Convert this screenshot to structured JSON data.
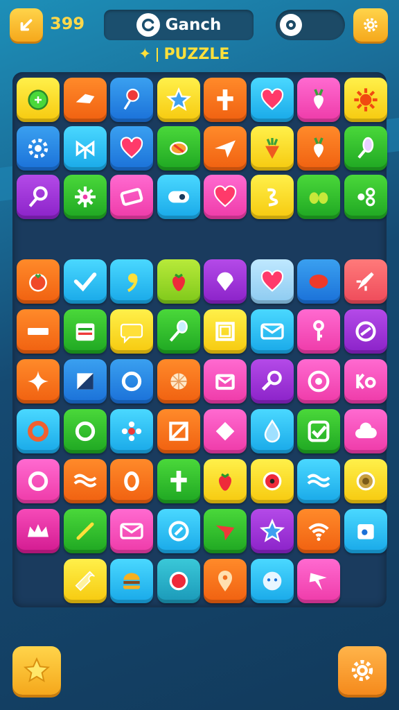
{
  "header": {
    "score": "399",
    "title": "Ganch",
    "subtitle_label": "PUZZLE"
  },
  "colors": {
    "accent": "#f5a81c",
    "score": "#ffd84a",
    "board_bg": "#1a3b5e"
  },
  "board": {
    "tiles": [
      {
        "row": 0,
        "col": 0,
        "color": "yellow",
        "icon": "green-button-icon"
      },
      {
        "row": 0,
        "col": 1,
        "color": "orange",
        "icon": "paper-icon"
      },
      {
        "row": 0,
        "col": 2,
        "color": "blue",
        "icon": "pin-icon"
      },
      {
        "row": 0,
        "col": 3,
        "color": "yellow",
        "icon": "star-icon"
      },
      {
        "row": 0,
        "col": 4,
        "color": "orange",
        "icon": "cross-icon"
      },
      {
        "row": 0,
        "col": 5,
        "color": "cyan",
        "icon": "heart-icon"
      },
      {
        "row": 0,
        "col": 6,
        "color": "pink",
        "icon": "radish-icon"
      },
      {
        "row": 0,
        "col": 7,
        "color": "yellow",
        "icon": "sun-icon"
      },
      {
        "row": 1,
        "col": 0,
        "color": "blue",
        "icon": "gear-icon"
      },
      {
        "row": 1,
        "col": 1,
        "color": "cyan",
        "icon": "bow-icon"
      },
      {
        "row": 1,
        "col": 2,
        "color": "blue",
        "icon": "heart-icon"
      },
      {
        "row": 1,
        "col": 3,
        "color": "green",
        "icon": "candy-icon"
      },
      {
        "row": 1,
        "col": 4,
        "color": "orange",
        "icon": "paper-plane-icon"
      },
      {
        "row": 1,
        "col": 5,
        "color": "yellow",
        "icon": "carrot-icon"
      },
      {
        "row": 1,
        "col": 6,
        "color": "orange",
        "icon": "radish-icon"
      },
      {
        "row": 1,
        "col": 7,
        "color": "green",
        "icon": "popsicle-icon"
      },
      {
        "row": 2,
        "col": 0,
        "color": "purple",
        "icon": "lollipop-icon"
      },
      {
        "row": 2,
        "col": 1,
        "color": "green",
        "icon": "splat-icon"
      },
      {
        "row": 2,
        "col": 2,
        "color": "pink",
        "icon": "tag-icon"
      },
      {
        "row": 2,
        "col": 3,
        "color": "cyan",
        "icon": "capsule-icon"
      },
      {
        "row": 2,
        "col": 4,
        "color": "pink",
        "icon": "heart-icon"
      },
      {
        "row": 2,
        "col": 5,
        "color": "yellow",
        "icon": "swirl-icon"
      },
      {
        "row": 2,
        "col": 6,
        "color": "green",
        "icon": "olives-icon"
      },
      {
        "row": 2,
        "col": 7,
        "color": "green",
        "icon": "circles-icon"
      },
      {
        "row": 3,
        "col": 0,
        "color": "orange",
        "icon": "tomato-icon"
      },
      {
        "row": 3,
        "col": 1,
        "color": "cyan",
        "icon": "checkmark-icon"
      },
      {
        "row": 3,
        "col": 2,
        "color": "cyan",
        "icon": "comma-icon"
      },
      {
        "row": 3,
        "col": 3,
        "color": "lime",
        "icon": "strawberry-icon"
      },
      {
        "row": 3,
        "col": 4,
        "color": "purple",
        "icon": "shell-icon"
      },
      {
        "row": 3,
        "col": 5,
        "color": "lightblue",
        "icon": "heart-icon"
      },
      {
        "row": 3,
        "col": 6,
        "color": "blue",
        "icon": "bean-icon"
      },
      {
        "row": 3,
        "col": 7,
        "color": "red",
        "icon": "rocket-icon"
      },
      {
        "row": 4,
        "col": 0,
        "color": "orange",
        "icon": "bar-icon"
      },
      {
        "row": 4,
        "col": 1,
        "color": "green",
        "icon": "calendar-icon"
      },
      {
        "row": 4,
        "col": 2,
        "color": "yellow",
        "icon": "speech-bubble-icon"
      },
      {
        "row": 4,
        "col": 3,
        "color": "green",
        "icon": "spoon-icon"
      },
      {
        "row": 4,
        "col": 4,
        "color": "yellow",
        "icon": "frame-icon"
      },
      {
        "row": 4,
        "col": 5,
        "color": "cyan",
        "icon": "envelope-icon"
      },
      {
        "row": 4,
        "col": 6,
        "color": "pink",
        "icon": "key-icon"
      },
      {
        "row": 4,
        "col": 7,
        "color": "purple",
        "icon": "circle-slash-icon"
      },
      {
        "row": 5,
        "col": 0,
        "color": "orange",
        "icon": "sparkle-icon"
      },
      {
        "row": 5,
        "col": 1,
        "color": "blue",
        "icon": "envelope-flag-icon"
      },
      {
        "row": 5,
        "col": 2,
        "color": "blue",
        "icon": "ring-icon"
      },
      {
        "row": 5,
        "col": 3,
        "color": "orange",
        "icon": "shell-round-icon"
      },
      {
        "row": 5,
        "col": 4,
        "color": "pink",
        "icon": "mailbox-icon"
      },
      {
        "row": 5,
        "col": 5,
        "color": "purple",
        "icon": "magnifier-icon"
      },
      {
        "row": 5,
        "col": 6,
        "color": "pink",
        "icon": "target-icon"
      },
      {
        "row": 5,
        "col": 7,
        "color": "pink",
        "icon": "ko-icon"
      },
      {
        "row": 6,
        "col": 0,
        "color": "cyan",
        "icon": "donut-icon"
      },
      {
        "row": 6,
        "col": 1,
        "color": "green",
        "icon": "ring-icon"
      },
      {
        "row": 6,
        "col": 2,
        "color": "cyan",
        "icon": "flower-icon"
      },
      {
        "row": 6,
        "col": 3,
        "color": "orange",
        "icon": "square-slash-icon"
      },
      {
        "row": 6,
        "col": 4,
        "color": "pink",
        "icon": "diamond-icon"
      },
      {
        "row": 6,
        "col": 5,
        "color": "cyan",
        "icon": "drop-icon"
      },
      {
        "row": 6,
        "col": 6,
        "color": "green",
        "icon": "check-box-icon"
      },
      {
        "row": 6,
        "col": 7,
        "color": "pink",
        "icon": "cloud-icon"
      },
      {
        "row": 7,
        "col": 0,
        "color": "pink",
        "icon": "ring-icon"
      },
      {
        "row": 7,
        "col": 1,
        "color": "orange",
        "icon": "waves-icon"
      },
      {
        "row": 7,
        "col": 2,
        "color": "orange",
        "icon": "zero-icon"
      },
      {
        "row": 7,
        "col": 3,
        "color": "green",
        "icon": "cross-icon"
      },
      {
        "row": 7,
        "col": 4,
        "color": "yellow",
        "icon": "strawberry-icon"
      },
      {
        "row": 7,
        "col": 5,
        "color": "yellow",
        "icon": "ladybug-icon"
      },
      {
        "row": 7,
        "col": 6,
        "color": "cyan",
        "icon": "waves-icon"
      },
      {
        "row": 7,
        "col": 7,
        "color": "yellow",
        "icon": "button-icon"
      },
      {
        "row": 8,
        "col": 0,
        "color": "magenta",
        "icon": "crown-icon"
      },
      {
        "row": 8,
        "col": 1,
        "color": "green",
        "icon": "stick-icon"
      },
      {
        "row": 8,
        "col": 2,
        "color": "pink",
        "icon": "envelope-icon"
      },
      {
        "row": 8,
        "col": 3,
        "color": "cyan",
        "icon": "at-icon"
      },
      {
        "row": 8,
        "col": 4,
        "color": "green",
        "icon": "arrow-icon"
      },
      {
        "row": 8,
        "col": 5,
        "color": "purple",
        "icon": "star-icon"
      },
      {
        "row": 8,
        "col": 6,
        "color": "orange",
        "icon": "wifi-icon"
      },
      {
        "row": 8,
        "col": 7,
        "color": "cyan",
        "icon": "camera-icon"
      },
      {
        "row": 9,
        "col": 1,
        "color": "yellow",
        "icon": "ticket-icon"
      },
      {
        "row": 9,
        "col": 2,
        "color": "cyan",
        "icon": "burger-icon"
      },
      {
        "row": 9,
        "col": 3,
        "color": "teal",
        "icon": "ball-icon"
      },
      {
        "row": 9,
        "col": 4,
        "color": "orange",
        "icon": "map-pin-icon"
      },
      {
        "row": 9,
        "col": 5,
        "color": "cyan",
        "icon": "face-icon"
      },
      {
        "row": 9,
        "col": 6,
        "color": "pink",
        "icon": "spark-icon"
      }
    ]
  },
  "footer": {
    "left_icon": "star-icon",
    "right_icon": "gear-icon"
  }
}
